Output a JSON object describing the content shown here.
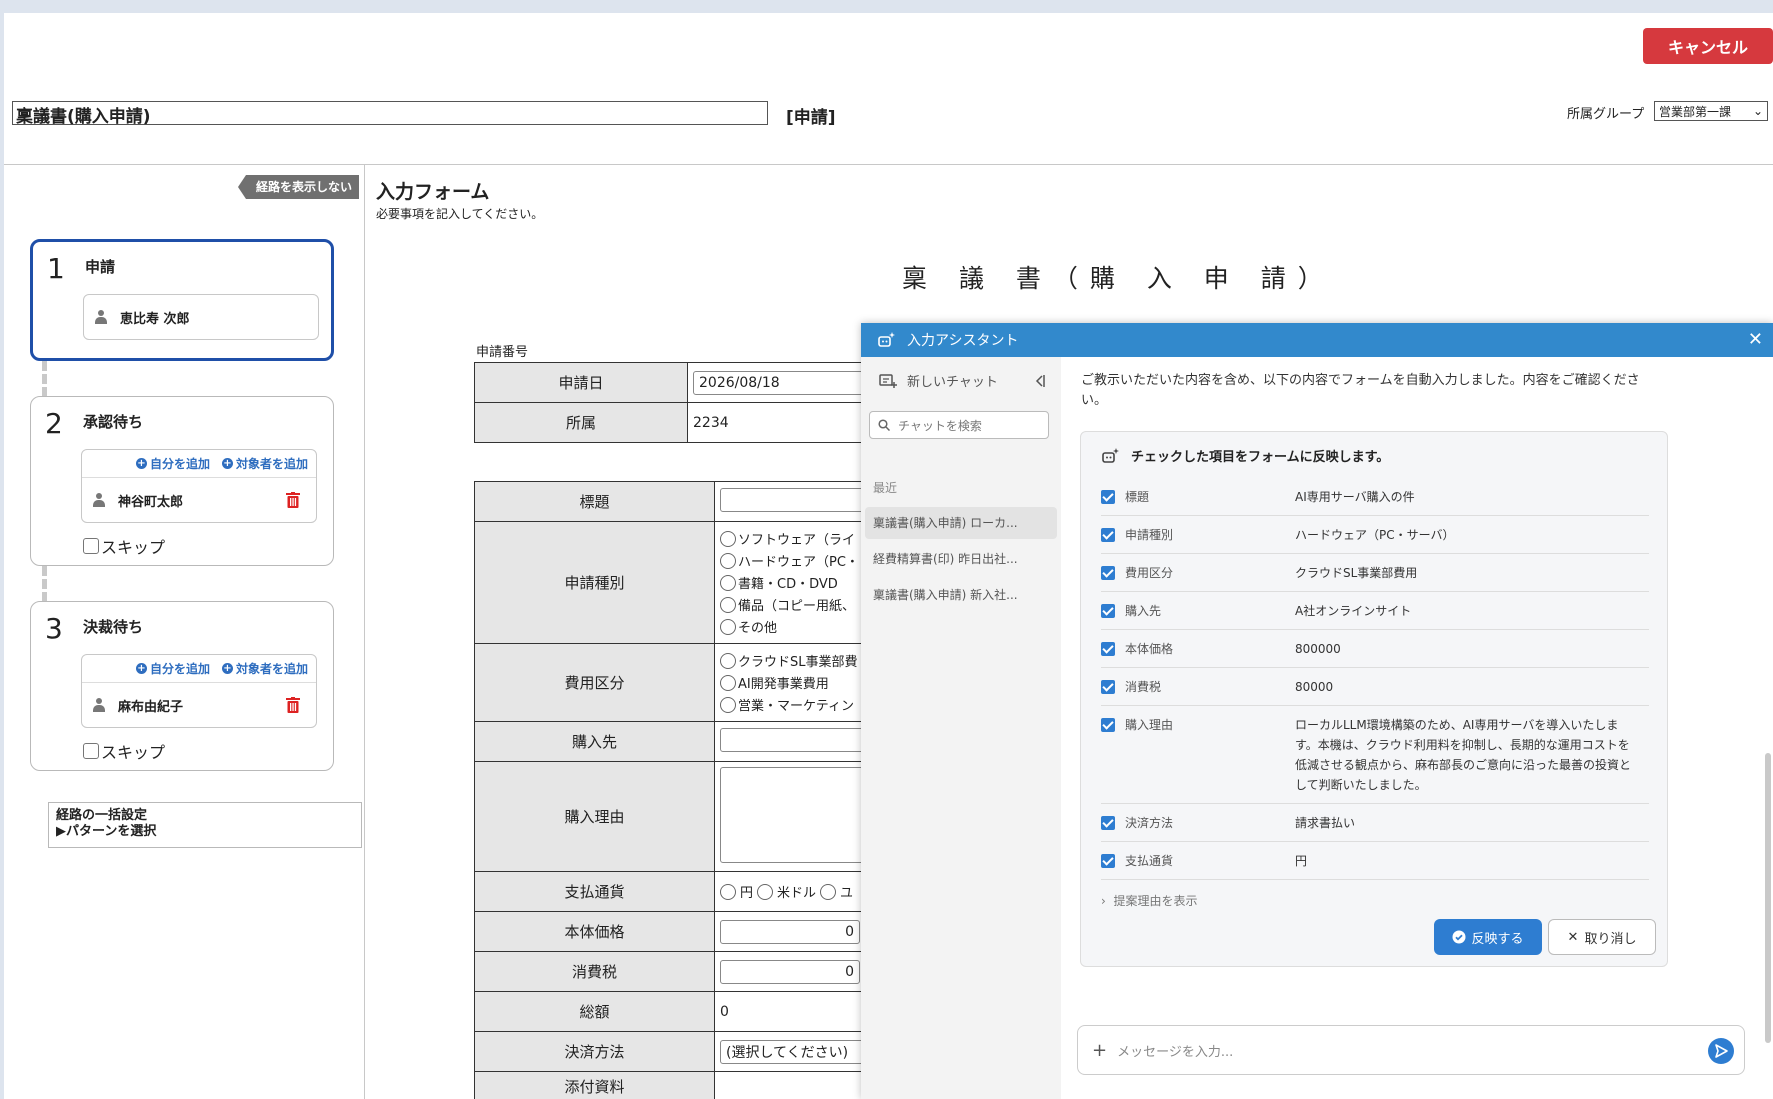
{
  "header": {
    "cancel_label": "キャンセル",
    "title_value": "稟議書(購入申請)",
    "title_suffix": "[申請]",
    "group_label": "所属グループ",
    "group_value": "営業部第一課"
  },
  "route": {
    "toggle_label": "経路を表示しない",
    "add_self": "自分を追加",
    "add_target": "対象者を追加",
    "skip_label": "スキップ",
    "steps": [
      {
        "num": "1",
        "title": "申請",
        "user": "恵比寿 次郎"
      },
      {
        "num": "2",
        "title": "承認待ち",
        "user": "神谷町太郎"
      },
      {
        "num": "3",
        "title": "決裁待ち",
        "user": "麻布由紀子"
      }
    ],
    "bulk_title": "経路の一括設定",
    "bulk_pattern": "▶パターンを選択"
  },
  "form": {
    "title": "入力フォーム",
    "subtitle": "必要事項を記入してください。",
    "doc_title": "稟 議 書（購 入 申 請）",
    "app_no_label": "申請番号",
    "date_label": "申請日",
    "date_value": "2026/08/18",
    "dept_label": "所属",
    "dept_value": "2234",
    "subject_label": "標題",
    "category_label": "申請種別",
    "category_options": [
      "ソフトウェア（ライ",
      "ハードウェア（PC・",
      "書籍・CD・DVD",
      "備品（コピー用紙、",
      "その他"
    ],
    "cost_label": "費用区分",
    "cost_options": [
      "クラウドSL事業部費",
      "AI開発事業費用",
      "営業・マーケティン"
    ],
    "vendor_label": "購入先",
    "reason_label": "購入理由",
    "currency_label": "支払通貨",
    "currency_options": [
      "円",
      "米ドル",
      "ユ"
    ],
    "price_label": "本体価格",
    "price_value": "0",
    "tax_label": "消費税",
    "tax_value": "0",
    "total_label": "総額",
    "total_value": "0",
    "payment_label": "決済方法",
    "payment_value": "(選択してください)",
    "attach_label": "添付資料"
  },
  "assistant": {
    "title": "入力アシスタント",
    "new_chat": "新しいチャット",
    "search_placeholder": "チャットを検索",
    "recent_label": "最近",
    "chats": [
      "稟議書(購入申請) ローカ...",
      "経費精算書(印) 昨日出社...",
      "稟議書(購入申請) 新入社..."
    ],
    "message": "ご教示いただいた内容を含め、以下の内容でフォームを自動入力しました。内容をご確認ください。",
    "card_title": "チェックした項目をフォームに反映します。",
    "items": [
      {
        "key": "標題",
        "value": "AI専用サーバ購入の件"
      },
      {
        "key": "申請種別",
        "value": "ハードウェア（PC・サーバ）"
      },
      {
        "key": "費用区分",
        "value": "クラウドSL事業部費用"
      },
      {
        "key": "購入先",
        "value": "A社オンラインサイト"
      },
      {
        "key": "本体価格",
        "value": "800000"
      },
      {
        "key": "消費税",
        "value": "80000"
      },
      {
        "key": "購入理由",
        "value": "ローカルLLM環境構築のため、AI専用サーバを導入いたします。本機は、クラウド利用料を抑制し、長期的な運用コストを低減させる観点から、麻布部長のご意向に沿った最善の投資として判断いたしました。"
      },
      {
        "key": "決済方法",
        "value": "請求書払い"
      },
      {
        "key": "支払通貨",
        "value": "円"
      }
    ],
    "reason_toggle": "提案理由を表示",
    "apply_label": "反映する",
    "undo_label": "取り消し",
    "input_placeholder": "メッセージを入力..."
  }
}
